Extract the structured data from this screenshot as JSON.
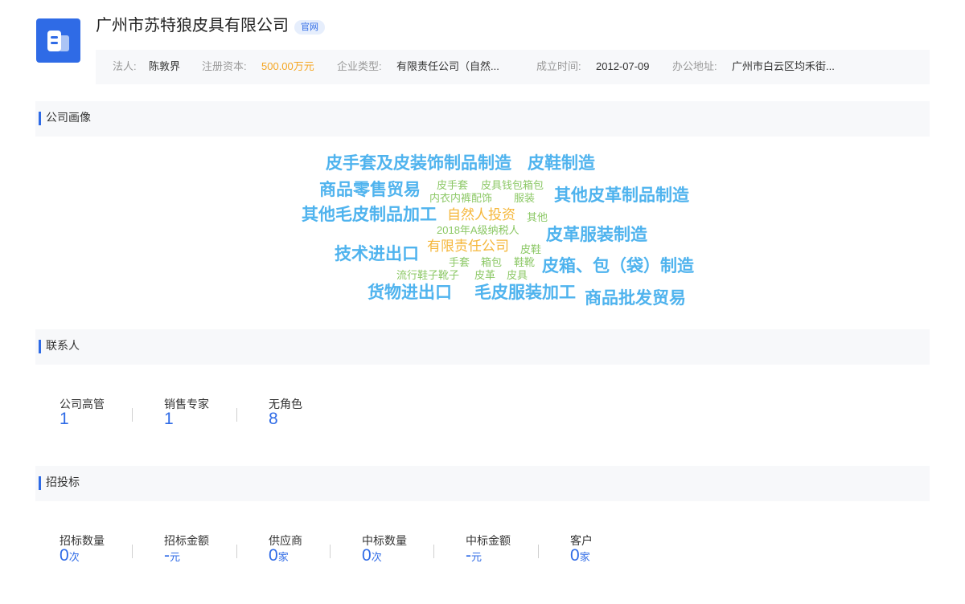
{
  "company": {
    "name": "广州市苏特狼皮具有限公司",
    "badge": "官网",
    "logo_icon": "building-icon",
    "accent_color": "#2f6be6"
  },
  "info": {
    "legal_label": "法人:",
    "legal_value": "陈敦界",
    "capital_label": "注册资本:",
    "capital_value": "500.00万元",
    "type_label": "企业类型:",
    "type_value": "有限责任公司（自然...",
    "founded_label": "成立时间:",
    "founded_value": "2012-07-09",
    "address_label": "办公地址:",
    "address_value": "广州市白云区均禾街..."
  },
  "sections": {
    "portrait": "公司画像",
    "contacts": "联系人",
    "bidding": "招投标"
  },
  "tags": [
    "皮手套及皮装饰制品制造",
    "皮鞋制造",
    "商品零售贸易",
    "皮手套",
    "皮具钱包箱包",
    "内衣内裤配饰",
    "服装",
    "其他皮革制品制造",
    "其他毛皮制品加工",
    "自然人投资",
    "其他",
    "2018年A级纳税人",
    "皮革服装制造",
    "有限责任公司",
    "皮鞋",
    "技术进出口",
    "手套",
    "箱包",
    "鞋靴",
    "皮箱、包（袋）制造",
    "流行鞋子靴子",
    "皮革",
    "皮具",
    "货物进出口",
    "毛皮服装加工",
    "商品批发贸易"
  ],
  "contacts": [
    {
      "label": "公司高管",
      "value": "1"
    },
    {
      "label": "销售专家",
      "value": "1"
    },
    {
      "label": "无角色",
      "value": "8"
    }
  ],
  "bidding": [
    {
      "label": "招标数量",
      "value": "0",
      "unit": "次"
    },
    {
      "label": "招标金额",
      "value": "-",
      "unit": "元"
    },
    {
      "label": "供应商",
      "value": "0",
      "unit": "家"
    },
    {
      "label": "中标数量",
      "value": "0",
      "unit": "次"
    },
    {
      "label": "中标金额",
      "value": "-",
      "unit": "元"
    },
    {
      "label": "客户",
      "value": "0",
      "unit": "家"
    }
  ]
}
